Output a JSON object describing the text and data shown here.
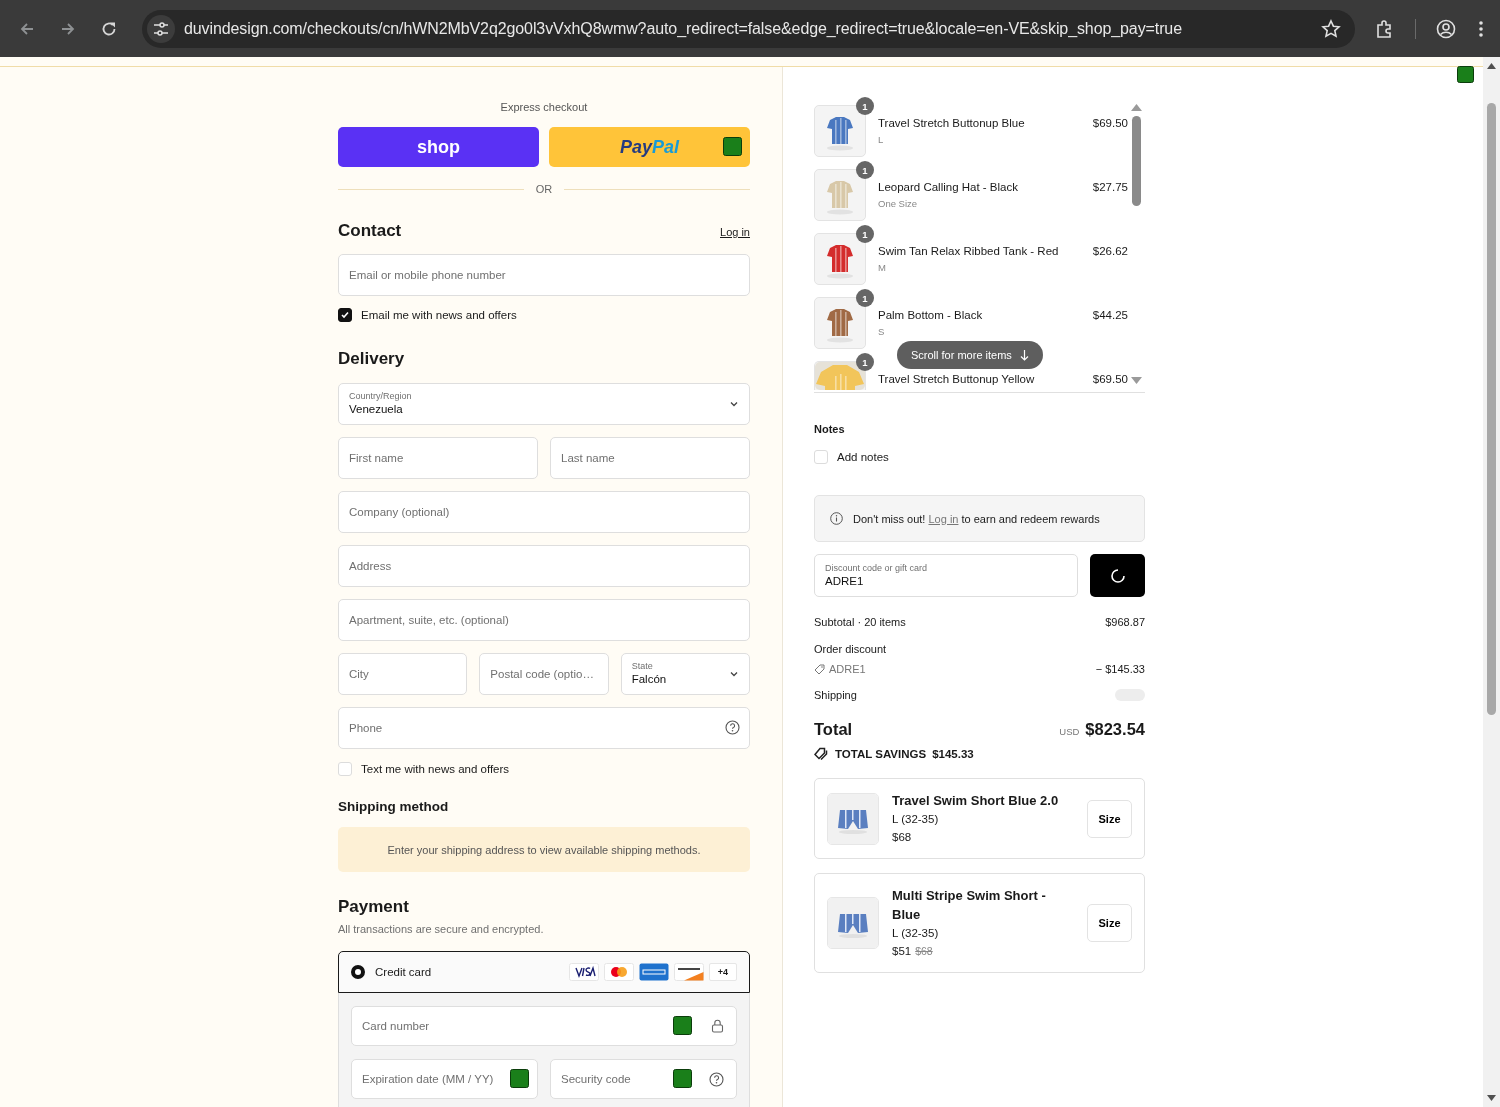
{
  "browser": {
    "url": "duvindesign.com/checkouts/cn/hWN2MbV2q2go0l3vVxhQ8wmw?auto_redirect=false&edge_redirect=true&locale=en-VE&skip_shop_pay=true"
  },
  "express": {
    "title": "Express checkout",
    "shop_label": "shop",
    "paypal": [
      "Pay",
      "Pal"
    ],
    "divider": "OR"
  },
  "contact": {
    "title": "Contact",
    "login": "Log in",
    "email_placeholder": "Email or mobile phone number",
    "newsletter": {
      "label": "Email me with news and offers",
      "checked": true
    }
  },
  "delivery": {
    "title": "Delivery",
    "rows": [
      [
        {
          "kind": "select",
          "label": "Country/Region",
          "value": "Venezuela"
        }
      ],
      [
        {
          "kind": "input",
          "placeholder": "First name"
        },
        {
          "kind": "input",
          "placeholder": "Last name"
        }
      ],
      [
        {
          "kind": "input",
          "placeholder": "Company (optional)"
        }
      ],
      [
        {
          "kind": "input",
          "placeholder": "Address"
        }
      ],
      [
        {
          "kind": "input",
          "placeholder": "Apartment, suite, etc. (optional)"
        }
      ],
      [
        {
          "kind": "input",
          "placeholder": "City"
        },
        {
          "kind": "input",
          "placeholder": "Postal code (optio…"
        },
        {
          "kind": "select",
          "label": "State",
          "value": "Falcón"
        }
      ],
      [
        {
          "kind": "phone",
          "placeholder": "Phone"
        }
      ]
    ],
    "sms": {
      "label": "Text me with news and offers",
      "checked": false
    }
  },
  "shipping_method": {
    "title": "Shipping method",
    "notice": "Enter your shipping address to view available shipping methods."
  },
  "payment": {
    "title": "Payment",
    "subtitle": "All transactions are secure and encrypted.",
    "method": {
      "label": "Credit card",
      "selected": true,
      "more": "+4"
    },
    "card_rows": [
      [
        {
          "placeholder": "Card number",
          "kind": "lock"
        }
      ],
      [
        {
          "placeholder": "Expiration date (MM / YY)",
          "kind": "plain"
        },
        {
          "placeholder": "Security code",
          "kind": "help"
        }
      ]
    ]
  },
  "cart": {
    "items": [
      {
        "name": "Travel Stretch Buttonup Blue",
        "variant": "L",
        "price": "$69.50",
        "quantity": "1"
      },
      {
        "name": "Leopard Calling Hat - Black",
        "variant": "One Size",
        "price": "$27.75",
        "quantity": "1"
      },
      {
        "name": "Swim Tan Relax Ribbed Tank - Red",
        "variant": "M",
        "price": "$26.62",
        "quantity": "1"
      },
      {
        "name": "Palm Bottom - Black",
        "variant": "S",
        "price": "$44.25",
        "quantity": "1"
      },
      {
        "name": "Travel Stretch Buttonup Yellow",
        "price": "$69.50",
        "quantity": "1"
      }
    ],
    "scroll_hint": "Scroll for more items"
  },
  "notes": {
    "title": "Notes",
    "add": {
      "label": "Add notes",
      "checked": false
    }
  },
  "rewards": {
    "before": "Don't miss out! ",
    "link": "Log in",
    "after": " to earn and redeem rewards"
  },
  "discount": {
    "label": "Discount code or gift card",
    "value": "ADRE1"
  },
  "summary": {
    "subtotal_label": "Subtotal · 20 items",
    "subtotal": "$968.87",
    "discount_label": "Order discount",
    "code": "ADRE1",
    "discount": "− $145.33",
    "shipping_label": "Shipping",
    "total_label": "Total",
    "currency": "USD",
    "total": "$823.54",
    "savings_label": "TOTAL SAVINGS",
    "savings": "$145.33"
  },
  "upsells": [
    {
      "name": "Travel Swim Short Blue 2.0",
      "variant": "L (32-35)",
      "price": "$68",
      "button": "Size"
    },
    {
      "name": "Multi Stripe Swim Short - Blue",
      "variant": "L (32-35)",
      "price": "$51",
      "compare": "$68",
      "button": "Size"
    }
  ]
}
